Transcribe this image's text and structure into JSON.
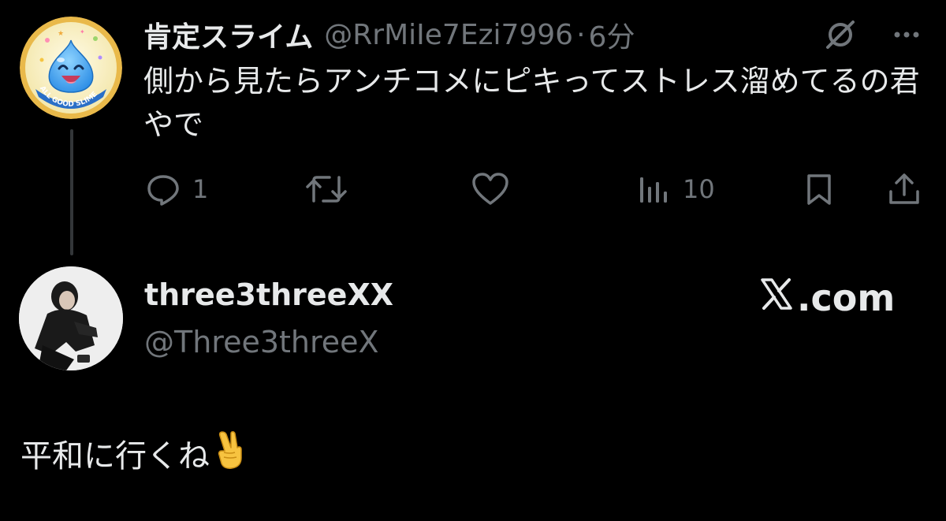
{
  "colors": {
    "background": "#000000",
    "primary_text": "#e7e9ea",
    "secondary_text": "#71767b",
    "thread_line": "#333639"
  },
  "tweet": {
    "display_name": "肯定スライム",
    "handle": "@RrMiIe7Ezi7996",
    "separator": "·",
    "time": "6分",
    "text": "側から見たらアンチコメにピキってストレス溜めてるの君やで",
    "avatar_text": "ALL GOOD SLIME",
    "avatar_icon": "smiling-blue-slime",
    "top_icons": [
      "grok-icon",
      "more-icon"
    ],
    "actions": {
      "reply_count": "1",
      "views_count": "10"
    },
    "action_icons": [
      "reply-icon",
      "retweet-icon",
      "like-icon",
      "views-icon",
      "bookmark-icon",
      "share-icon"
    ]
  },
  "quoted_account": {
    "display_name": "three3threeXX",
    "handle": "@Three3threeX",
    "site_label": ".com",
    "avatar_icon": "monochrome-portrait-photo"
  },
  "caption": {
    "text": "平和に行くね",
    "emoji_icon": "victory-hand-emoji"
  }
}
